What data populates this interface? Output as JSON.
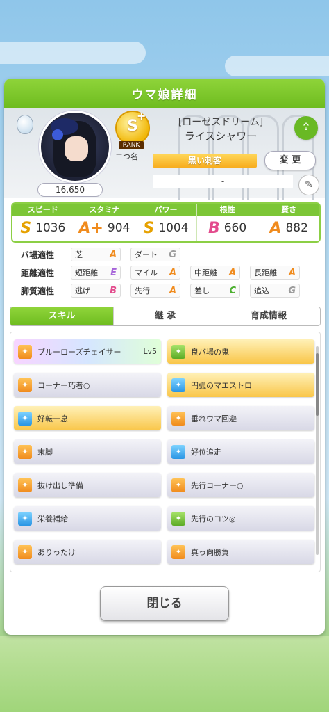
{
  "colors": {
    "accent_green": "#7cc636",
    "rank_gold": "#f1b80a",
    "grade_S": "#e6a100",
    "grade_A": "#f08b1d",
    "grade_B": "#e34b8d",
    "grade_C": "#4caf2f",
    "grade_E": "#a562d9",
    "grade_G": "#9a9a9a"
  },
  "panel": {
    "title": "ウマ娘詳細"
  },
  "character": {
    "rank": "S",
    "rank_plus": "+",
    "rank_label": "RANK",
    "nickname": "二つ名",
    "title": "[ローゼスドリーム]",
    "name": "ライスシャワー",
    "alias": "黒い刺客",
    "change_label": "変 更",
    "goal_text": "-",
    "fans": "16,650",
    "share_icon": "share-icon",
    "edit_icon": "pencil-icon"
  },
  "stats": [
    {
      "label": "スピード",
      "grade": "S",
      "value": "1036"
    },
    {
      "label": "スタミナ",
      "grade": "A+",
      "value": "904"
    },
    {
      "label": "パワー",
      "grade": "S",
      "value": "1004"
    },
    {
      "label": "根性",
      "grade": "B",
      "value": "660"
    },
    {
      "label": "賢さ",
      "grade": "A",
      "value": "882"
    }
  ],
  "aptitude": {
    "rows": [
      {
        "label": "バ場適性",
        "cells": [
          {
            "name": "芝",
            "grade": "A"
          },
          {
            "name": "ダート",
            "grade": "G"
          }
        ]
      },
      {
        "label": "距離適性",
        "cells": [
          {
            "name": "短距離",
            "grade": "E"
          },
          {
            "name": "マイル",
            "grade": "A"
          },
          {
            "name": "中距離",
            "grade": "A"
          },
          {
            "name": "長距離",
            "grade": "A"
          }
        ]
      },
      {
        "label": "脚質適性",
        "cells": [
          {
            "name": "逃げ",
            "grade": "B"
          },
          {
            "name": "先行",
            "grade": "A"
          },
          {
            "name": "差し",
            "grade": "C"
          },
          {
            "name": "追込",
            "grade": "G"
          }
        ]
      }
    ]
  },
  "tabs": [
    {
      "label": "スキル",
      "active": true
    },
    {
      "label": "継 承",
      "active": false
    },
    {
      "label": "育成情報",
      "active": false
    }
  ],
  "skills": [
    {
      "name": "ブルーローズチェイサー",
      "level": "Lv5",
      "style": "rainbow",
      "icon": "orange"
    },
    {
      "name": "良バ場の鬼",
      "level": "",
      "style": "gold",
      "icon": "green"
    },
    {
      "name": "コーナー巧者○",
      "level": "",
      "style": "normal",
      "icon": "orange"
    },
    {
      "name": "円弧のマエストロ",
      "level": "",
      "style": "gold",
      "icon": "blue"
    },
    {
      "name": "好転一息",
      "level": "",
      "style": "gold",
      "icon": "blue"
    },
    {
      "name": "垂れウマ回避",
      "level": "",
      "style": "normal",
      "icon": "orange"
    },
    {
      "name": "末脚",
      "level": "",
      "style": "normal",
      "icon": "orange"
    },
    {
      "name": "好位追走",
      "level": "",
      "style": "normal",
      "icon": "blue"
    },
    {
      "name": "抜け出し準備",
      "level": "",
      "style": "normal",
      "icon": "orange"
    },
    {
      "name": "先行コーナー○",
      "level": "",
      "style": "normal",
      "icon": "orange"
    },
    {
      "name": "栄養補給",
      "level": "",
      "style": "normal",
      "icon": "blue"
    },
    {
      "name": "先行のコツ◎",
      "level": "",
      "style": "normal",
      "icon": "green"
    },
    {
      "name": "ありったけ",
      "level": "",
      "style": "normal",
      "icon": "orange"
    },
    {
      "name": "真っ向勝負",
      "level": "",
      "style": "normal",
      "icon": "orange"
    }
  ],
  "close_label": "閉じる"
}
